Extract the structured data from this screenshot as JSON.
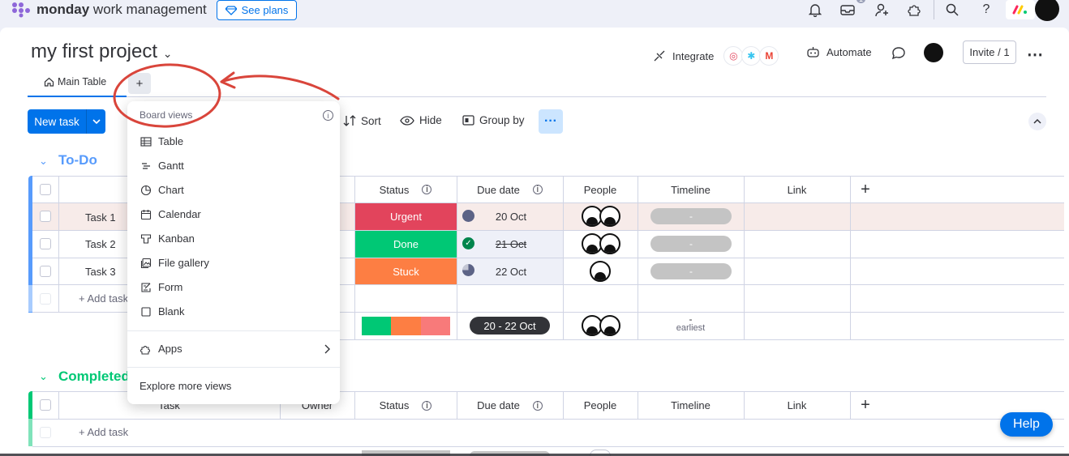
{
  "app": {
    "brand_bold": "monday",
    "brand_rest": " work management",
    "see_plans": "See plans",
    "badge": "1"
  },
  "board": {
    "title": "my first project",
    "tabs": [
      {
        "label": "Main Table"
      }
    ],
    "add_tab": "+",
    "integrate": "Integrate",
    "automate": "Automate",
    "invite": "Invite / 1"
  },
  "toolbar": {
    "new_task": "New task",
    "sort": "Sort",
    "hide": "Hide",
    "group_by": "Group by",
    "more": "···"
  },
  "columns": {
    "status": "Status",
    "due_date": "Due date",
    "people": "People",
    "timeline": "Timeline",
    "link": "Link",
    "task": "Task",
    "owner": "Owner",
    "add": "+"
  },
  "groups": [
    {
      "name": "To-Do",
      "color": "#579bfc",
      "rows": [
        {
          "task": "Task 1",
          "status": "Urgent",
          "status_color": "#e2445c",
          "due": "20 Oct",
          "due_strike": false,
          "people": 2,
          "timeline": "-"
        },
        {
          "task": "Task 2",
          "status": "Done",
          "status_color": "#00c875",
          "due": "21 Oct",
          "due_strike": true,
          "people": 2,
          "timeline": "-"
        },
        {
          "task": "Task 3",
          "status": "Stuck",
          "status_color": "#fd7e43",
          "due": "22 Oct",
          "due_strike": false,
          "people": 1,
          "timeline": "-"
        }
      ],
      "add_task": "+ Add task",
      "summary": {
        "due_range": "20 - 22 Oct",
        "timeline": "-",
        "timeline_sub": "earliest"
      }
    },
    {
      "name": "Completed",
      "color": "#00c875",
      "add_task": "+ Add task"
    }
  ],
  "menu": {
    "header": "Board views",
    "items": [
      {
        "label": "Table",
        "icon": "table-icon"
      },
      {
        "label": "Gantt",
        "icon": "gantt-icon"
      },
      {
        "label": "Chart",
        "icon": "chart-icon"
      },
      {
        "label": "Calendar",
        "icon": "calendar-icon"
      },
      {
        "label": "Kanban",
        "icon": "kanban-icon"
      },
      {
        "label": "File gallery",
        "icon": "file-gallery-icon"
      },
      {
        "label": "Form",
        "icon": "form-icon"
      },
      {
        "label": "Blank",
        "icon": "blank-icon"
      }
    ],
    "apps": "Apps",
    "explore": "Explore more views"
  },
  "help": "Help",
  "colors": {
    "accent": "#0073ea",
    "annotation": "#d9453b",
    "urgent": "#e2445c",
    "done": "#00c875",
    "stuck": "#fd7e43"
  }
}
